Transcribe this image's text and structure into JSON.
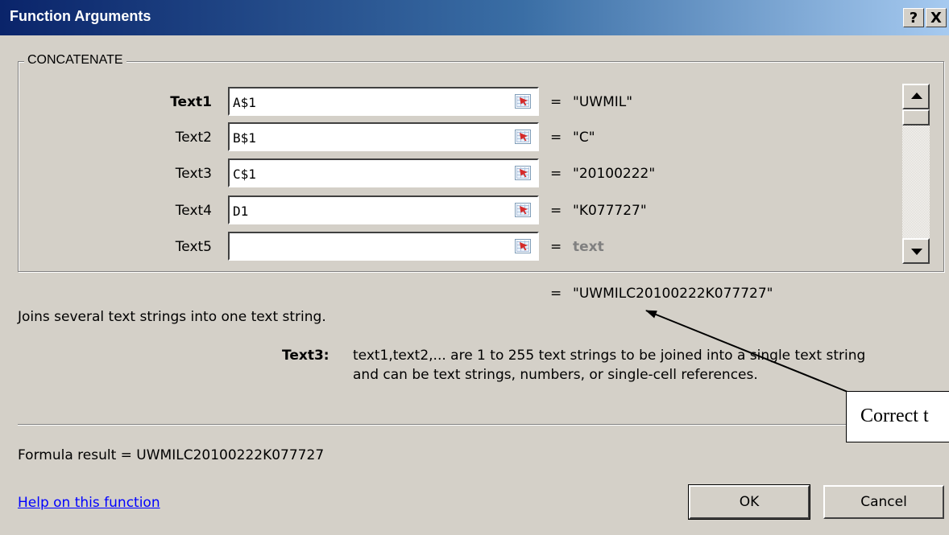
{
  "dialog": {
    "title": "Function Arguments",
    "help_button": "?",
    "close_button": "X"
  },
  "function": {
    "name": "CONCATENATE",
    "args": [
      {
        "label": "Text1",
        "value": "A$1",
        "result": "\"UWMIL\""
      },
      {
        "label": "Text2",
        "value": "B$1",
        "result": "\"C\""
      },
      {
        "label": "Text3",
        "value": "C$1",
        "result": "\"20100222\""
      },
      {
        "label": "Text4",
        "value": "D1",
        "result": "\"K077727\""
      },
      {
        "label": "Text5",
        "value": "",
        "result": "text"
      }
    ],
    "equals": "=",
    "combined_result": "\"UWMILC20100222K077727\"",
    "description": "Joins several text strings into one text string.",
    "arg_help_name": "Text3:",
    "arg_help_line1": "text1,text2,... are 1 to 255 text strings to be joined into a single text string",
    "arg_help_line2": "and can be text strings, numbers, or single-cell references."
  },
  "footer": {
    "formula_result": "Formula result =  UWMILC20100222K077727",
    "help_link": "Help on this function",
    "ok_label": "OK",
    "cancel_label": "Cancel"
  },
  "annotation": {
    "callout_text": "Correct t"
  }
}
